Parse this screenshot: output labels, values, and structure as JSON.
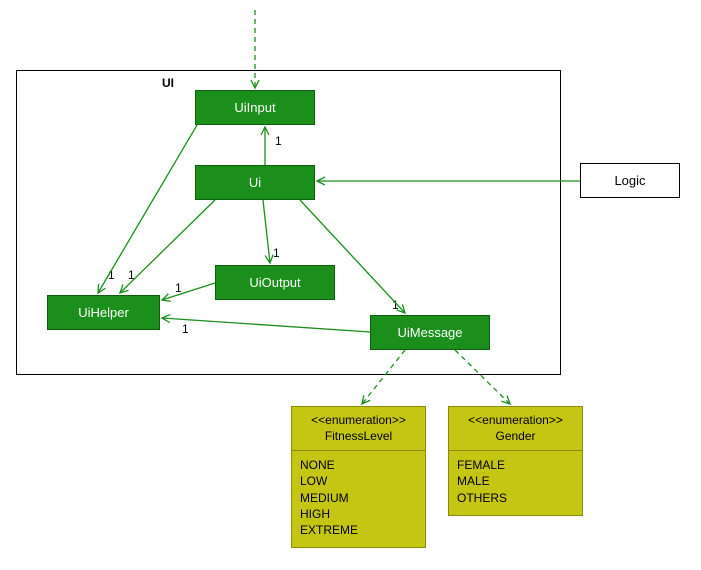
{
  "package": {
    "label": "UI"
  },
  "classes": {
    "uiInput": "UiInput",
    "ui": "Ui",
    "uiOutput": "UiOutput",
    "uiHelper": "UiHelper",
    "uiMessage": "UiMessage"
  },
  "external": {
    "logic": "Logic"
  },
  "enums": {
    "fitnessLevel": {
      "stereotype": "<<enumeration>>",
      "name": "FitnessLevel",
      "values": [
        "NONE",
        "LOW",
        "MEDIUM",
        "HIGH",
        "EXTREME"
      ]
    },
    "gender": {
      "stereotype": "<<enumeration>>",
      "name": "Gender",
      "values": [
        "FEMALE",
        "MALE",
        "OTHERS"
      ]
    }
  },
  "multiplicities": {
    "m1": "1",
    "m2": "1",
    "m3": "1",
    "m4": "1",
    "m5": "1",
    "m6": "1",
    "m7": "1"
  },
  "colors": {
    "classFill": "#1B8E1B",
    "enumFill": "#C5C514",
    "line": "#1B8E1B"
  }
}
